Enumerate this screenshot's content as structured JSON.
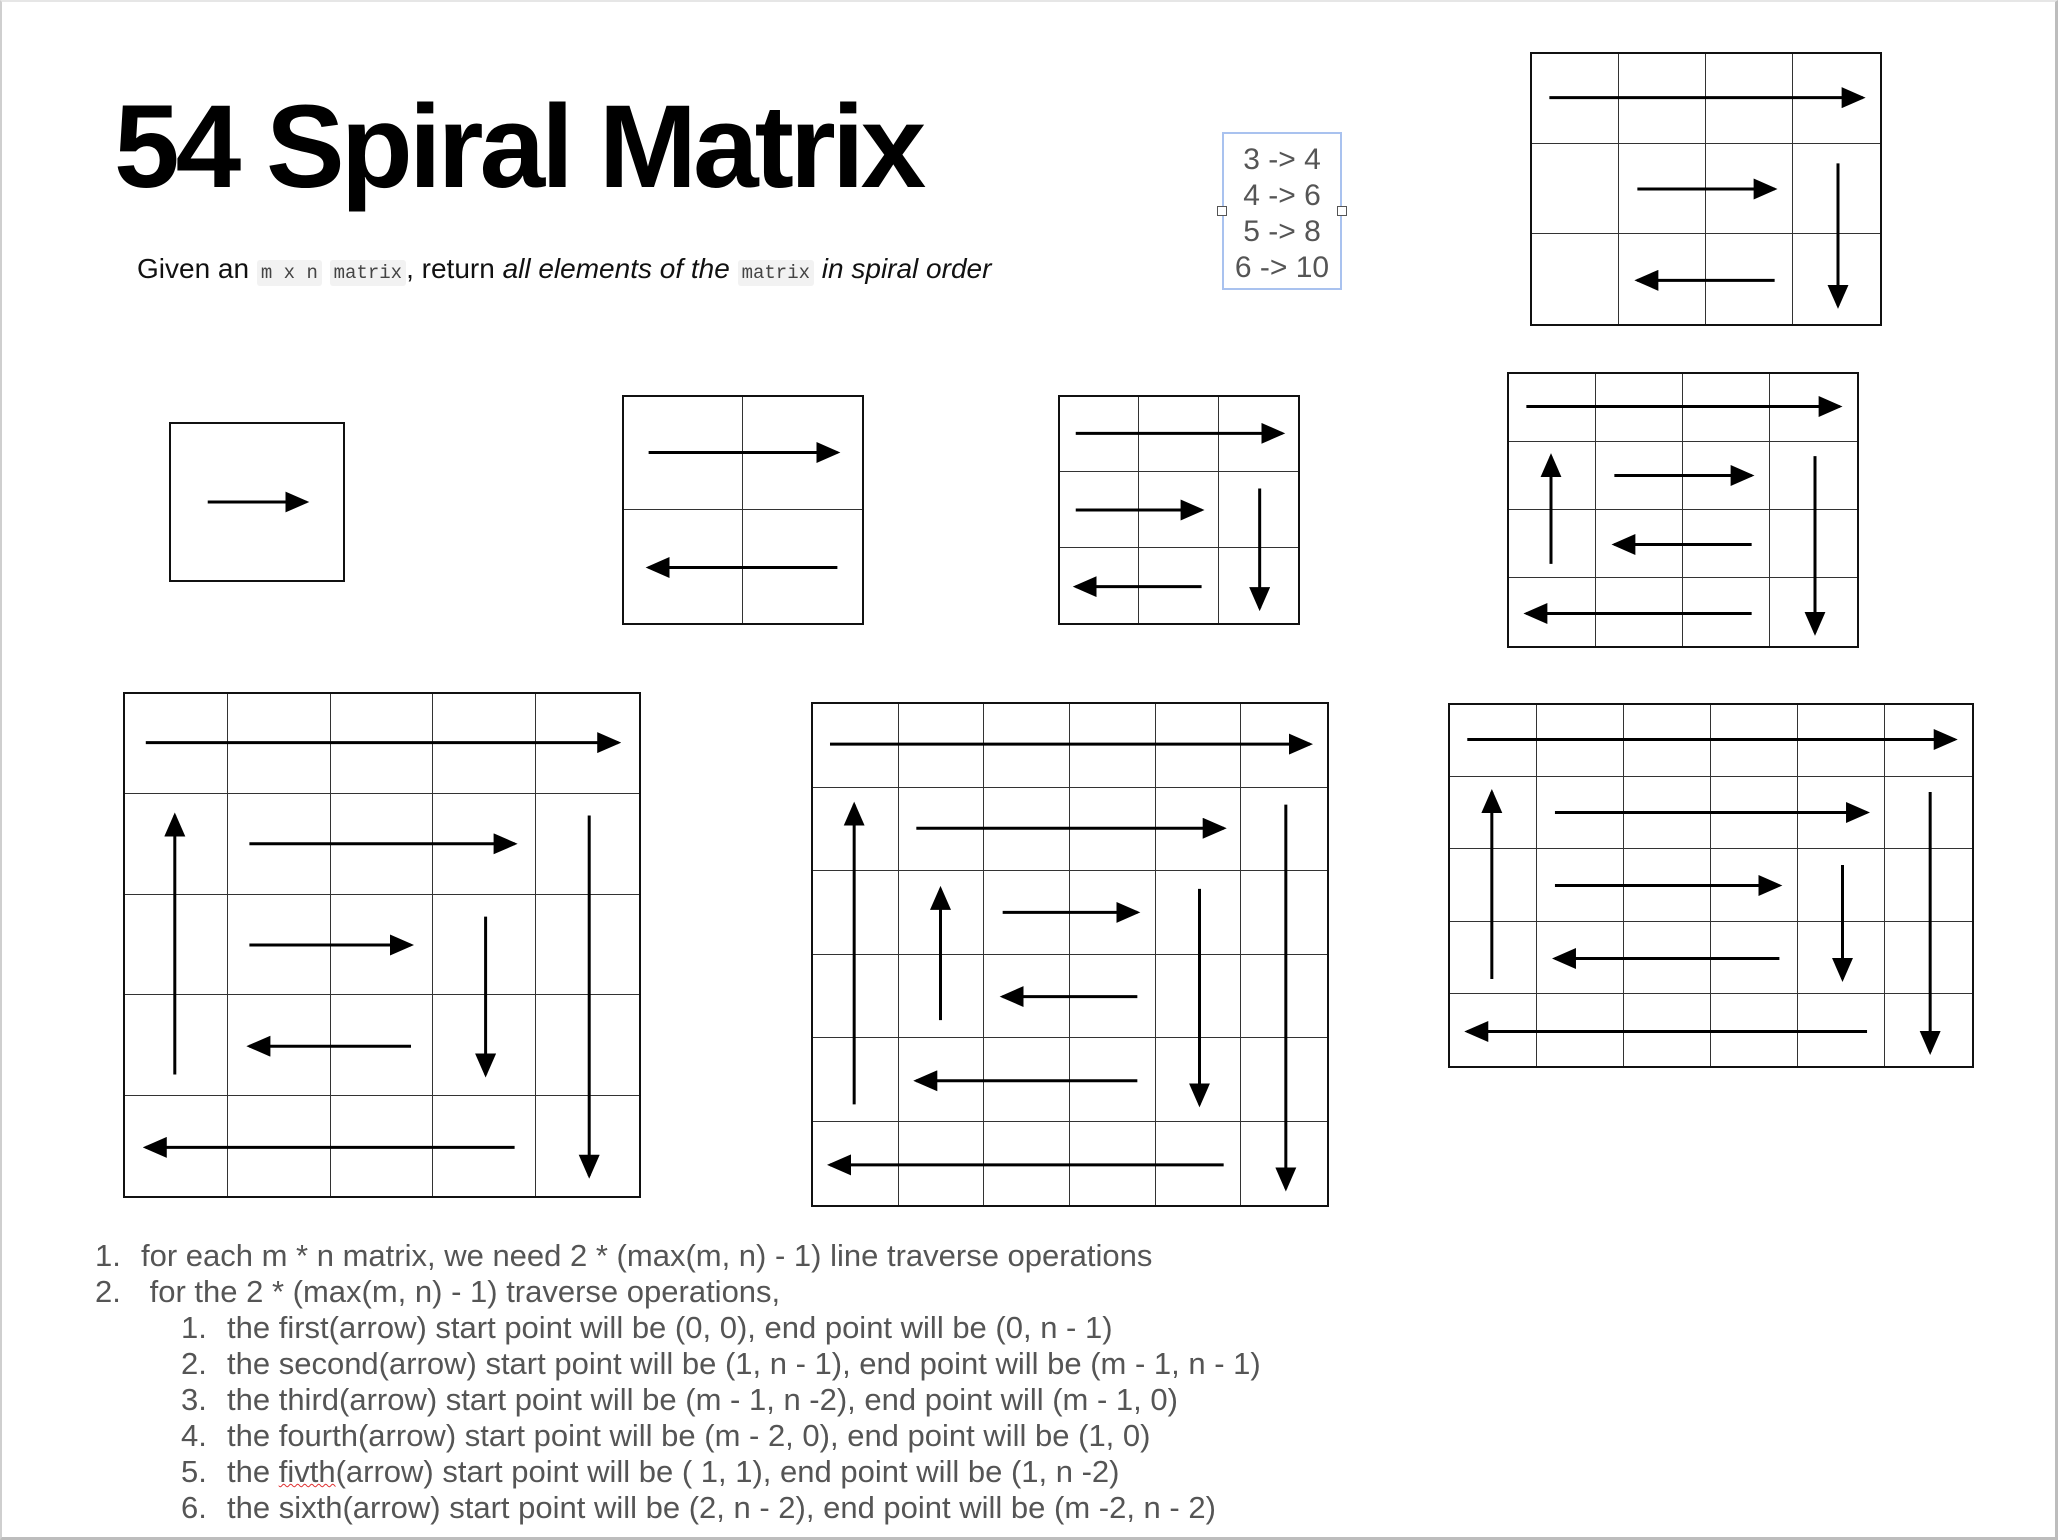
{
  "title": "54 Spiral Matrix",
  "subtitle": {
    "given": "Given an ",
    "code_mn": "m x n",
    "code_matrix": "matrix",
    "comma_return": ", return ",
    "em_all": "all elements of the",
    "code_matrix2": "matrix",
    "em_order": "in spiral order"
  },
  "ratio_box": [
    "3 -> 4",
    "4 -> 6",
    "5 -> 8",
    "6 -> 10"
  ],
  "grids": [
    {
      "rows": 1,
      "cols": 1,
      "arrows": [
        [
          0,
          0,
          0,
          0
        ]
      ]
    },
    {
      "rows": 2,
      "cols": 2,
      "arrows": [
        [
          0,
          0,
          0,
          1
        ],
        [
          1,
          1,
          1,
          0
        ]
      ]
    },
    {
      "rows": 3,
      "cols": 3,
      "arrows": [
        [
          0,
          0,
          0,
          2
        ],
        [
          1,
          0,
          1,
          1
        ],
        [
          1,
          2,
          2,
          2
        ],
        [
          2,
          1,
          2,
          0
        ]
      ]
    },
    {
      "rows": 3,
      "cols": 4,
      "arrows": [
        [
          0,
          0,
          0,
          3
        ],
        [
          1,
          3,
          2,
          3
        ],
        [
          2,
          2,
          2,
          1
        ],
        [
          1,
          1,
          1,
          2
        ]
      ]
    },
    {
      "rows": 4,
      "cols": 4,
      "arrows": [
        [
          0,
          0,
          0,
          3
        ],
        [
          1,
          3,
          3,
          3
        ],
        [
          3,
          2,
          3,
          0
        ],
        [
          2,
          0,
          1,
          0
        ],
        [
          1,
          1,
          1,
          2
        ],
        [
          2,
          2,
          2,
          1
        ]
      ]
    },
    {
      "rows": 5,
      "cols": 5,
      "arrows": [
        [
          0,
          0,
          0,
          4
        ],
        [
          1,
          4,
          4,
          4
        ],
        [
          4,
          3,
          4,
          0
        ],
        [
          3,
          0,
          1,
          0
        ],
        [
          1,
          1,
          1,
          3
        ],
        [
          2,
          3,
          3,
          3
        ],
        [
          3,
          2,
          3,
          1
        ],
        [
          2,
          1,
          2,
          2
        ]
      ]
    },
    {
      "rows": 6,
      "cols": 6,
      "arrows": [
        [
          0,
          0,
          0,
          5
        ],
        [
          1,
          5,
          5,
          5
        ],
        [
          5,
          4,
          5,
          0
        ],
        [
          4,
          0,
          1,
          0
        ],
        [
          1,
          1,
          1,
          4
        ],
        [
          2,
          4,
          4,
          4
        ],
        [
          4,
          3,
          4,
          1
        ],
        [
          3,
          1,
          2,
          1
        ],
        [
          2,
          2,
          2,
          3
        ],
        [
          3,
          3,
          3,
          2
        ]
      ]
    },
    {
      "rows": 5,
      "cols": 6,
      "arrows": [
        [
          0,
          0,
          0,
          5
        ],
        [
          1,
          5,
          4,
          5
        ],
        [
          4,
          4,
          4,
          0
        ],
        [
          3,
          0,
          1,
          0
        ],
        [
          1,
          1,
          1,
          4
        ],
        [
          2,
          4,
          3,
          4
        ],
        [
          3,
          3,
          3,
          1
        ],
        [
          2,
          1,
          2,
          3
        ]
      ]
    }
  ],
  "notes": {
    "items": [
      {
        "num": "1.",
        "text": "for each m * n matrix, we need 2 * (max(m, n)  - 1) line traverse operations"
      },
      {
        "num": "2.",
        "text": " for the 2 * (max(m, n)  - 1) traverse operations,"
      }
    ],
    "sub": [
      {
        "num": "1.",
        "text": "the first(arrow) start point will be (0, 0), end point will be (0, n - 1)"
      },
      {
        "num": "2.",
        "text": "the second(arrow) start point will be (1, n - 1), end point will be (m - 1, n - 1)"
      },
      {
        "num": "3.",
        "text": "the third(arrow) start point will be (m - 1, n -2), end point will (m - 1, 0)"
      },
      {
        "num": "4.",
        "text": "the fourth(arrow) start point will be (m - 2, 0), end point will be (1, 0)"
      },
      {
        "num": "5.",
        "pre": "the ",
        "misspelled": "fivth",
        "text": "(arrow) start point will be ( 1, 1), end point will be (1, n -2)"
      },
      {
        "num": "6.",
        "text": "the sixth(arrow) start point will be (2, n - 2), end point will be (m -2, n - 2)"
      }
    ]
  }
}
